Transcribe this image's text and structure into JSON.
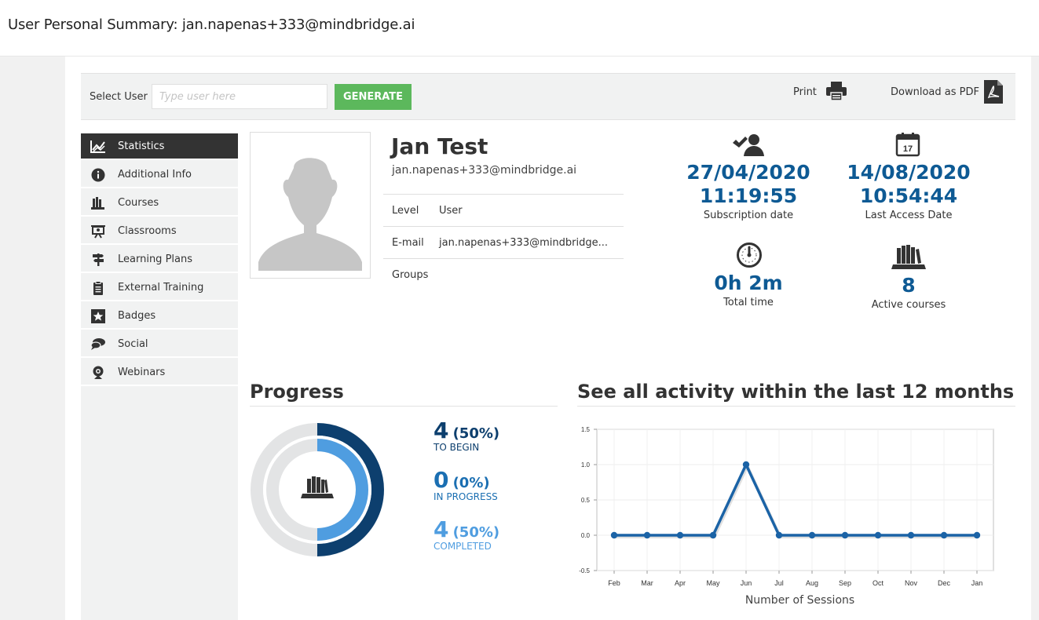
{
  "page_title": "User Personal Summary: jan.napenas+333@mindbridge.ai",
  "toolbar": {
    "select_user_label": "Select User",
    "user_placeholder": "Type user here",
    "generate_label": "GENERATE",
    "print_label": "Print",
    "download_label": "Download as PDF"
  },
  "sidebar": {
    "items": [
      {
        "label": "Statistics",
        "icon": "chart-icon"
      },
      {
        "label": "Additional Info",
        "icon": "info-icon"
      },
      {
        "label": "Courses",
        "icon": "books-icon"
      },
      {
        "label": "Classrooms",
        "icon": "classroom-icon"
      },
      {
        "label": "Learning Plans",
        "icon": "signpost-icon"
      },
      {
        "label": "External Training",
        "icon": "clipboard-icon"
      },
      {
        "label": "Badges",
        "icon": "star-icon"
      },
      {
        "label": "Social",
        "icon": "chat-icon"
      },
      {
        "label": "Webinars",
        "icon": "webcam-icon"
      }
    ]
  },
  "profile": {
    "name": "Jan Test",
    "email": "jan.napenas+333@mindbridge.ai",
    "rows": [
      {
        "key": "Level",
        "value": "User"
      },
      {
        "key": "E-mail",
        "value": "jan.napenas+333@mindbridge..."
      },
      {
        "key": "Groups",
        "value": ""
      }
    ]
  },
  "stats": {
    "subscription": {
      "date": "27/04/2020",
      "time": "11:19:55",
      "caption": "Subscription date"
    },
    "last_access": {
      "date": "14/08/2020",
      "time": "10:54:44",
      "caption": "Last Access Date"
    },
    "total_time": {
      "value": "0h 2m",
      "caption": "Total time"
    },
    "active_courses": {
      "value": "8",
      "caption": "Active courses"
    }
  },
  "progress": {
    "title": "Progress",
    "to_begin": {
      "count": "4",
      "pct": "(50%)",
      "label": "TO BEGIN"
    },
    "in_progress": {
      "count": "0",
      "pct": "(0%)",
      "label": "IN PROGRESS"
    },
    "completed": {
      "count": "4",
      "pct": "(50%)",
      "label": "COMPLETED"
    },
    "colors": {
      "to_begin": "#0d3f6e",
      "in_progress": "#1b6fb2",
      "completed": "#4f9de0",
      "track": "#e3e4e5"
    }
  },
  "activity": {
    "title": "See all activity within the last 12 months"
  },
  "chart_data": {
    "type": "line",
    "categories": [
      "Feb",
      "Mar",
      "Apr",
      "May",
      "Jun",
      "Jul",
      "Aug",
      "Sep",
      "Oct",
      "Nov",
      "Dec",
      "Jan"
    ],
    "series": [
      {
        "values": [
          0,
          0,
          0,
          0,
          1,
          0,
          0,
          0,
          0,
          0,
          0,
          0
        ]
      }
    ],
    "xlabel": "Number of Sessions",
    "ylabel": "",
    "ylim": [
      -0.5,
      1.5
    ],
    "yticks": [
      "1.5",
      "1.0",
      "0.5",
      "0.0",
      "-0.5"
    ],
    "color": "#1b63a6",
    "grid": true
  }
}
